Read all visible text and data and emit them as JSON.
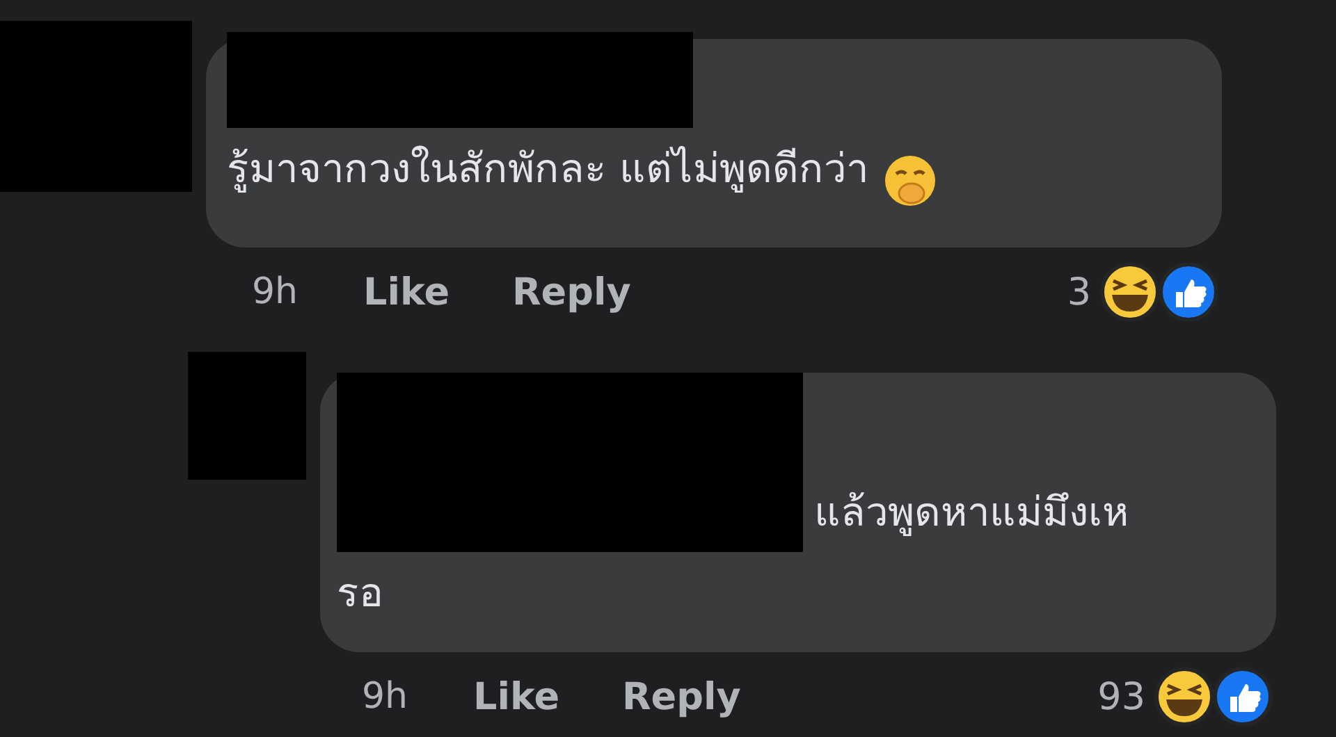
{
  "comments": [
    {
      "text_lines": [
        "รู้มาจากวงในสักพักละ แต่ไม่พูดดีกว่า"
      ],
      "emoji": true,
      "time": "9h",
      "actions": [
        "Like",
        "Reply"
      ],
      "reaction_count": "3"
    },
    {
      "text_lines": [
        "แล้วพูดหาแม่มึงเห",
        "รอ"
      ],
      "emoji": false,
      "time": "9h",
      "actions": [
        "Like",
        "Reply"
      ],
      "reaction_count": "93"
    }
  ]
}
